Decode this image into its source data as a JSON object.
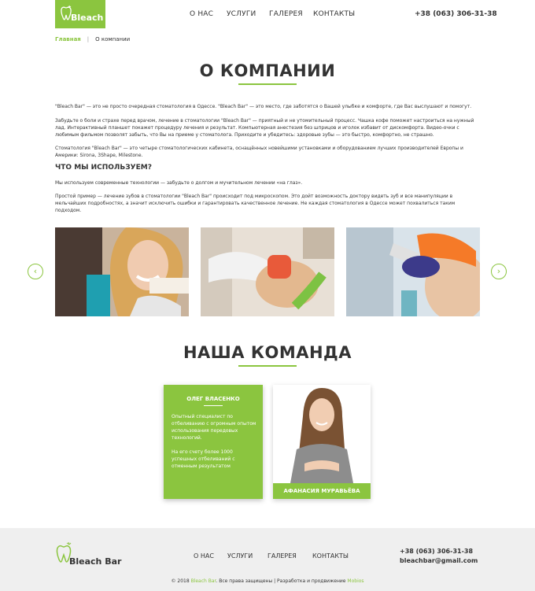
{
  "header": {
    "logo_text": "Bleach Bar",
    "nav": [
      "О НАС",
      "УСЛУГИ",
      "ГАЛЕРЕЯ",
      "КОНТАКТЫ"
    ],
    "phone": "+38 (063) 306-31-38"
  },
  "breadcrumb": {
    "home": "Главная",
    "separator": "|",
    "current": "О компании"
  },
  "about": {
    "title": "О КОМПАНИИ",
    "p1": "\"Bleach Bar\" — это не просто очередная стоматология в Одессе. \"Bleach Bar\" — это место, где заботятся о Вашей улыбке и комфорте, где Вас выслушают и помогут.",
    "p2": "Забудьте о боли и страхе перед врачом, лечение в стоматологии  \"Bleach Bar\" — приятный и не утомительный процесс. Чашка кофе поможет настроиться на нужный лад. Интерактивный планшет покажет процедуру лечения и результат.  Компьютерная анестезия без шприцов и иголок избавит от дискомфорта. Видео-очки с любимым фильмом позволят забыть, что Вы на приеме у стоматолога. Приходите и убедитесь: здоровые зубы — это быстро, комфортно, не страшно.",
    "p3": "Стоматология  \"Bleach Bar\" — это четыре стоматологических кабинета, оснащённых новейшими установками и оборудованием лучших производителей Европы и Америки: Sirona, 3Shape, Milestone.",
    "subtitle": "ЧТО МЫ ИСПОЛЬЗУЕМ?",
    "p4": "Мы используем современные технологии — забудьте о долгом и мучительном лечении «на глаз».",
    "p5": "Простой пример — лечение зубов в стоматологии  \"Bleach Bar\" происходит под микроскопом. Это дойт возможность доктору видеть зуб и все манипуляции в мельчайших подробностях, а значит исключить ошибки и гарантировать качественное лечение. Не каждая стоматология в Одессе может похвалиться таким подходом."
  },
  "gallery": {
    "prev_icon": "‹",
    "next_icon": "›"
  },
  "team": {
    "title": "НАША КОМАНДА",
    "member1": {
      "name": "ОЛЕГ ВЛАСЕНКО",
      "desc1": "Опытный специалист по отбеливанию с огромным опытом использования передовых технологий.",
      "desc2": "На его счету более 1000 успешных отбеливаний с отменным результатом"
    },
    "member2": {
      "name": "АФАНАСИЯ МУРАВЬЁВА"
    }
  },
  "footer": {
    "logo_text": "Bleach Bar",
    "nav": [
      "О НАС",
      "УСЛУГИ",
      "ГАЛЕРЕЯ",
      "КОНТАКТЫ"
    ],
    "phone": "+38 (063) 306-31-38",
    "email": "bleachbar@gmail.com",
    "copy_prefix": "© 2018 ",
    "copy_brand": "Bleach Bar",
    "copy_mid": ". Все права защищены | Разработка и продвижение ",
    "copy_dev": "Mobios"
  },
  "colors": {
    "accent": "#8bc53f",
    "footer_bg": "#efefef",
    "text": "#333333"
  }
}
